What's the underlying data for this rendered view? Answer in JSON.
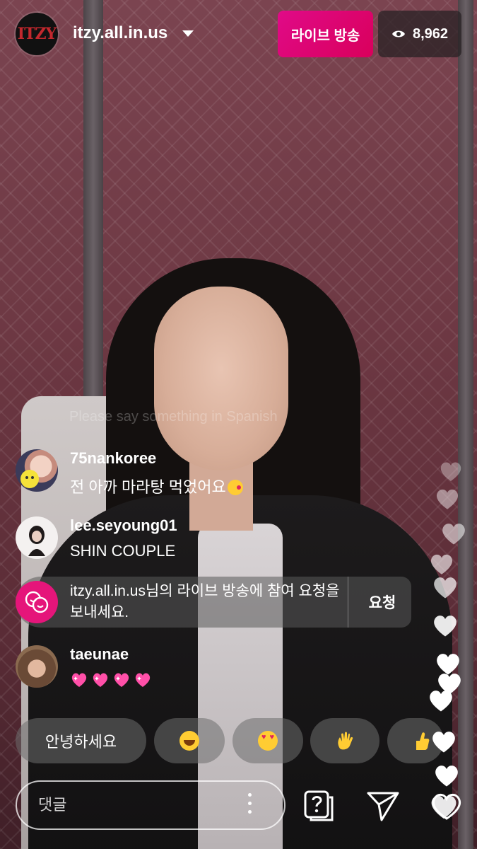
{
  "header": {
    "host_avatar_text": "ITZY",
    "host_name": "itzy.all.in.us",
    "live_label": "라이브 방송",
    "viewer_count": "8,962"
  },
  "faded_comment": "Please say something in Spanish",
  "comments": [
    {
      "user": "75nankoree",
      "text": "전 아까 마라탕 먹었어요"
    },
    {
      "user": "lee.seyoung01",
      "text": "SHIN COUPLE"
    },
    {
      "user": "taeunae",
      "text": ""
    }
  ],
  "request": {
    "text": "itzy.all.in.us님의 라이브 방송에 참여 요청을 보내세요.",
    "button": "요청"
  },
  "quick_replies": {
    "greeting": "안녕하세요",
    "emojis": [
      "laugh-emoji",
      "heart-eyes-emoji",
      "waving-hand-emoji",
      "thumbs-up-emoji"
    ]
  },
  "bottom_bar": {
    "comment_placeholder": "댓글"
  },
  "colors": {
    "live_badge": "#e00a88",
    "request_icon": "#e5157a",
    "heart_pink": "#ff4fa8"
  }
}
